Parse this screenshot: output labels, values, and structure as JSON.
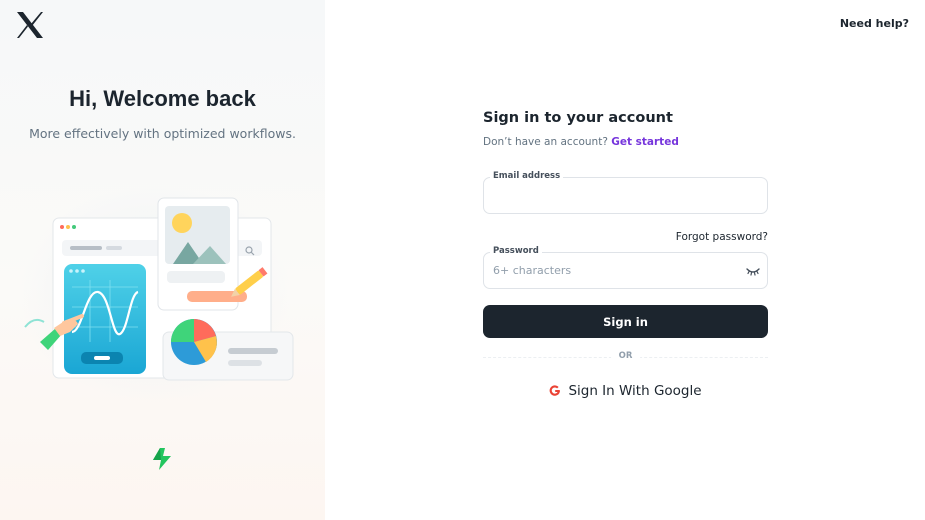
{
  "brand": {
    "logo_icon": "x-logo-icon"
  },
  "hero": {
    "title": "Hi, Welcome back",
    "subtitle": "More effectively with optimized workflows."
  },
  "header": {
    "help_label": "Need help?"
  },
  "login": {
    "title": "Sign in to your account",
    "no_account_text": "Don’t have an account?",
    "get_started_label": "Get started",
    "email": {
      "label": "Email address",
      "value": "",
      "placeholder": ""
    },
    "forgot_label": "Forgot password?",
    "password": {
      "label": "Password",
      "value": "",
      "placeholder": "6+ characters",
      "toggle_icon": "eye-closed-icon"
    },
    "submit_label": "Sign in",
    "divider_label": "OR",
    "google_label": "Sign In With Google"
  },
  "colors": {
    "primary": "#1c252e",
    "accent_link": "#7635dc",
    "google_red": "#ea4335",
    "bolt_green": "#22c55e"
  }
}
